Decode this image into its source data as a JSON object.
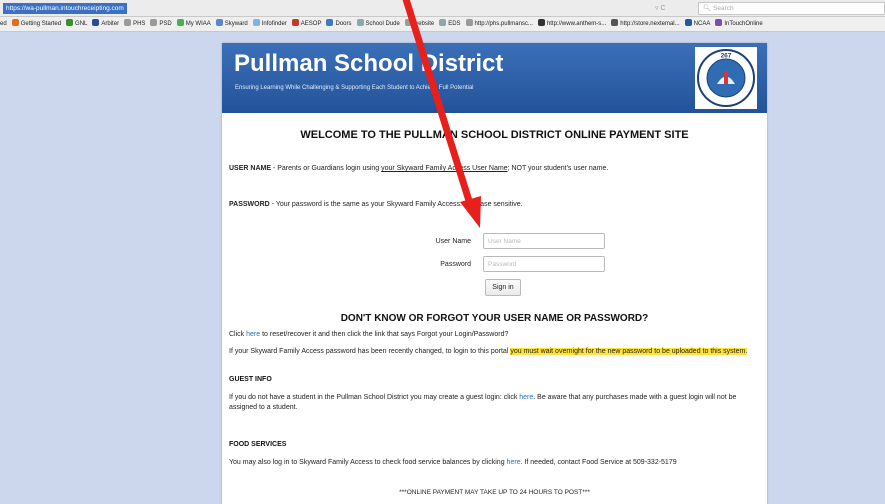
{
  "browser": {
    "url": "https://wa-pullman.intouchreceipting.com",
    "url_controls": "▿  C",
    "search_placeholder": "Search",
    "bookmarks": [
      {
        "label": "ed",
        "icon": "none",
        "color": "#ececec"
      },
      {
        "label": "Getting Started",
        "icon": "firefox-icon",
        "color": "#e66b1c"
      },
      {
        "label": "GNL",
        "icon": "chart-icon",
        "color": "#3c8d2f"
      },
      {
        "label": "Arbiter",
        "icon": "arbiter-icon",
        "color": "#2a4d9b"
      },
      {
        "label": "PHS",
        "icon": "dash-icon",
        "color": "#9a9a9a"
      },
      {
        "label": "PSD",
        "icon": "dash-icon",
        "color": "#9a9a9a"
      },
      {
        "label": "My WIAA",
        "icon": "wiaa-icon",
        "color": "#4caf50"
      },
      {
        "label": "Skyward",
        "icon": "skyward-icon",
        "color": "#5b86c9"
      },
      {
        "label": "Infofinder",
        "icon": "page-icon",
        "color": "#7fb3e0"
      },
      {
        "label": "AESOP",
        "icon": "aesop-icon",
        "color": "#c0392b"
      },
      {
        "label": "Doors",
        "icon": "doors-icon",
        "color": "#3c7bbf"
      },
      {
        "label": "School Dude",
        "icon": "globe-icon",
        "color": "#8aa"
      },
      {
        "label": "website",
        "icon": "dash-icon",
        "color": "#9a9a9a"
      },
      {
        "label": "EDS",
        "icon": "globe-icon",
        "color": "#8aa"
      },
      {
        "label": "http://phs.pullmansc...",
        "icon": "dash-icon",
        "color": "#9a9a9a"
      },
      {
        "label": "http://www.anthem-s...",
        "icon": "anthem-icon",
        "color": "#333"
      },
      {
        "label": "http://store.nextemal...",
        "icon": "n-icon",
        "color": "#555"
      },
      {
        "label": "NCAA",
        "icon": "ncaa-icon",
        "color": "#1e5aa8"
      },
      {
        "label": "InTouchOnline",
        "icon": "intouch-icon",
        "color": "#7a4db0"
      }
    ]
  },
  "banner": {
    "title": "Pullman School District",
    "tagline": "Ensuring Learning While Challenging & Supporting Each Student to Achieve Full Potential",
    "logo_text": "PULLMAN PUBLIC SCHOOLS",
    "logo_year": "267"
  },
  "welcome": "WELCOME TO THE PULLMAN SCHOOL DISTRICT ONLINE PAYMENT SITE",
  "username_note": {
    "label": "USER NAME",
    "text_before": " - Parents or Guardians login using ",
    "underlined": "your Skyward Family Access User Name",
    "text_after": "; NOT your student's user name."
  },
  "password_note": {
    "label": "PASSWORD",
    "text": " - Your password is the same as your Skyward Family Access.  It is case sensitive."
  },
  "login": {
    "username_label": "User Name",
    "username_placeholder": "User Name",
    "password_label": "Password",
    "password_placeholder": "Password",
    "signin_label": "Sign in"
  },
  "forgot": {
    "heading": "DON'T KNOW OR FORGOT YOUR USER NAME OR PASSWORD?",
    "click": "Click ",
    "here": "here",
    "rest": " to reset/recover it and then click the link that says Forgot your Login/Password?",
    "changed_before": "If your Skyward Family Access password has been recently changed, to login to this portal ",
    "changed_highlight": "you must wait overnight for the new password to be uploaded to this system."
  },
  "guest": {
    "heading": "GUEST INFO",
    "text_before": "If you do not have a student in the Pullman School District you may create a guest login: click ",
    "here": "here",
    "text_after": ".  Be aware that any purchases made with a guest login will not be assigned to a student."
  },
  "food": {
    "heading": "FOOD SERVICES",
    "text_before": "You may also log in to Skyward Family Access to check food service balances by clicking ",
    "here": "here",
    "text_after": ".  If needed, contact Food Service at 509-332-5179"
  },
  "footer_note": "***ONLINE PAYMENT MAY TAKE UP TO 24 HOURS TO POST***",
  "colors": {
    "background": "#ccd7ee",
    "banner": "#2d5ea9",
    "link": "#1f6fd1",
    "highlight": "#ffe33b",
    "arrow": "#e8201c"
  }
}
